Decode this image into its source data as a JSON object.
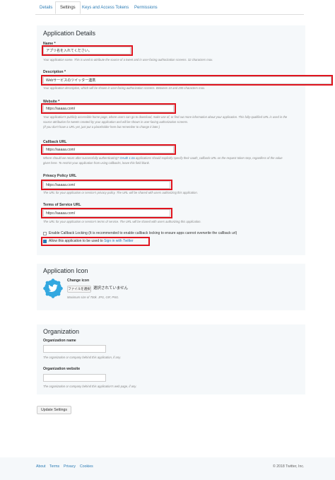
{
  "tabs": [
    "Details",
    "Settings",
    "Keys and Access Tokens",
    "Permissions"
  ],
  "app_details": {
    "title": "Application Details",
    "name": {
      "label": "Name *",
      "value": "アプリ名を入れてください。",
      "help": "Your application name. This is used to attribute the source of a tweet and in user-facing authorization screens. 32 characters max."
    },
    "description": {
      "label": "Description *",
      "value": "Webサービスのツイッター連携",
      "help": "Your application description, which will be shown in user-facing authorization screens. Between 10 and 200 characters max."
    },
    "website": {
      "label": "Website *",
      "value": "https://aaaaa.com/",
      "help1": "Your application's publicly accessible home page, where users can go to download, make use of, or find out more information about your application. This fully-qualified URL is used in the",
      "help2": "source attribution for tweets created by your application and will be shown in user-facing authorization screens.",
      "help3": "(If you don't have a URL yet, just put a placeholder here but remember to change it later.)"
    },
    "callback": {
      "label": "Callback URL",
      "value": "https://aaaaa.com/",
      "help1_pre": "Where should we return after successfully authenticating?",
      "help1_link": "OAuth 1.0a",
      "help1_post": "applications should explicitly specify their oauth_callback URL on the request token step, regardless of the value",
      "help2": "given here. To restrict your application from using callbacks, leave this field blank."
    },
    "privacy": {
      "label": "Privacy Policy URL",
      "value": "https://aaaaa.com/",
      "help": "The URL for your application or service's privacy policy. The URL will be shared with users authorizing this application."
    },
    "tos": {
      "label": "Terms of Service URL",
      "value": "https://aaaaa.com/",
      "help": "The URL for your application or service's terms of service. The URL will be shared with users authorizing this application."
    },
    "callback_locking": "Enable Callback Locking (It is recommended to enable callback locking to ensure apps cannot overwrite the callback url)",
    "sign_in_pre": "Allow this application to be used to",
    "sign_in_link": "Sign in with Twitter"
  },
  "app_icon": {
    "title": "Application Icon",
    "change_label": "Change icon",
    "file_button": "ファイルを選択",
    "file_status": "選択されていません",
    "help": "Maximum size of 700k. JPG, GIF, PNG."
  },
  "organization": {
    "title": "Organization",
    "name_label": "Organization name",
    "name_help": "The organization or company behind this application, if any.",
    "website_label": "Organization website",
    "website_help": "The organization or company behind this application's web page, if any."
  },
  "update_button": "Update Settings",
  "footer": {
    "links": [
      "About",
      "Terms",
      "Privacy",
      "Cookies"
    ],
    "copyright": "© 2018 Twitter, Inc."
  },
  "colors": {
    "accent": "#2a7bb5",
    "highlight": "#e0141e",
    "panel": "#f5f8fa"
  }
}
